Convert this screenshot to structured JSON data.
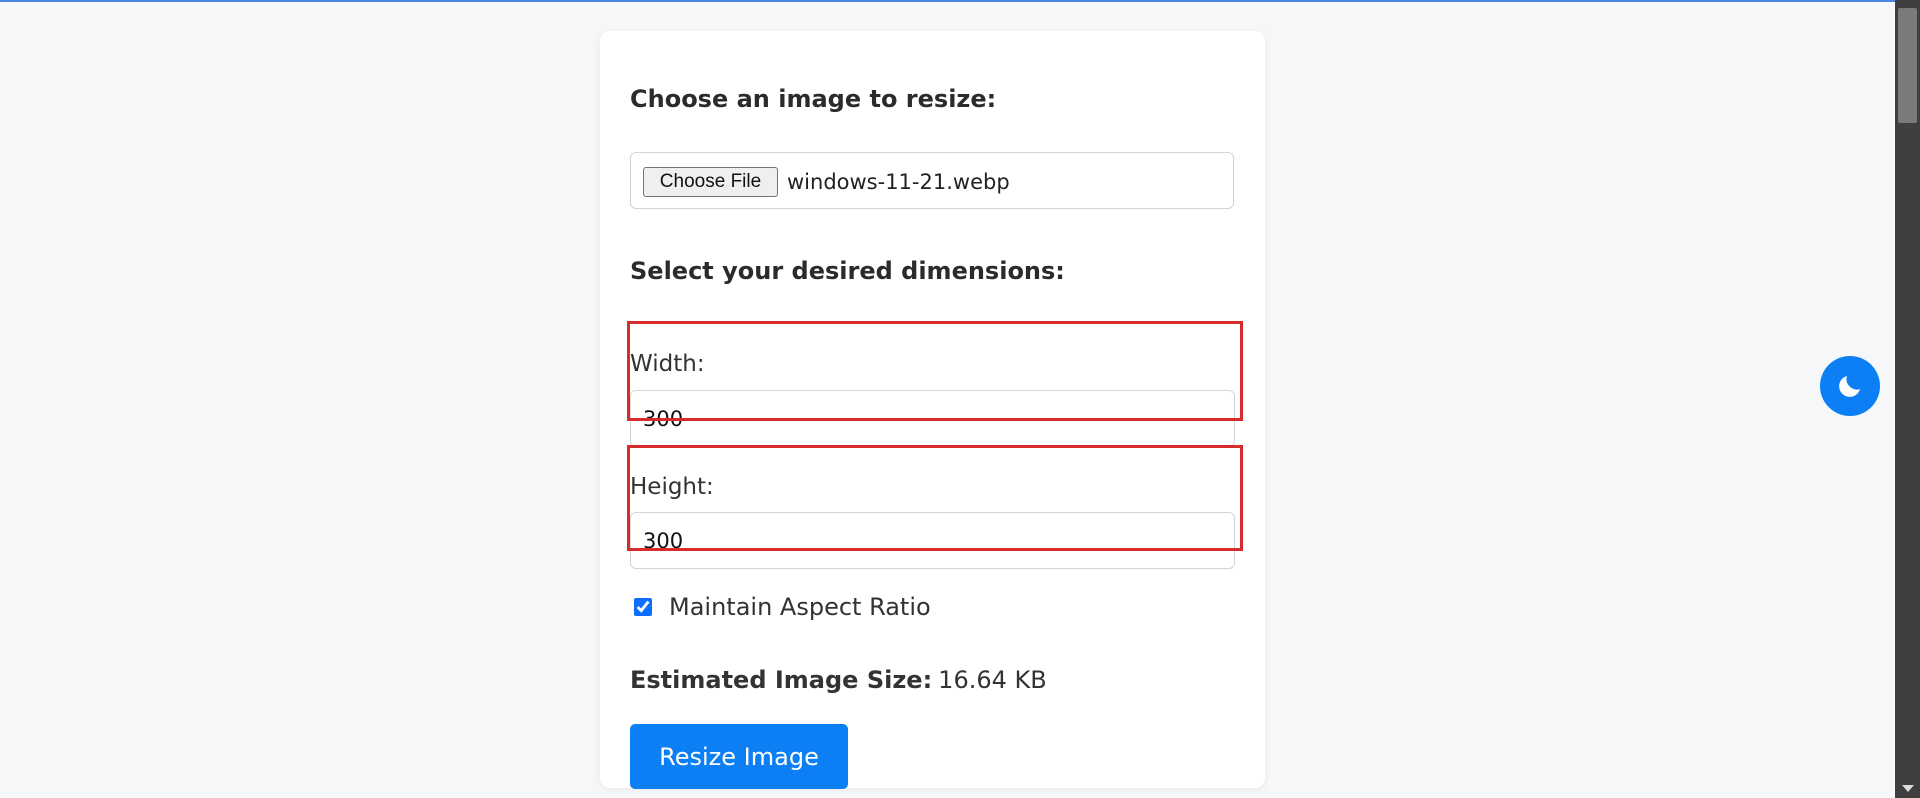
{
  "form": {
    "choose_title": "Choose an image to resize:",
    "choose_file_label": "Choose File",
    "file_name": "windows-11-21.webp",
    "dimensions_title": "Select your desired dimensions:",
    "width_label": "Width:",
    "width_value": "300",
    "height_label": "Height:",
    "height_value": "300",
    "maintain_aspect_label": "Maintain Aspect Ratio",
    "maintain_aspect_checked": true,
    "estimated_label": "Estimated Image Size:",
    "estimated_value": "16.64 KB",
    "resize_button_label": "Resize Image"
  },
  "theme_toggle": {
    "icon": "moon-icon"
  },
  "colors": {
    "accent": "#0d7ff5",
    "highlight": "#d62c2c",
    "background": "#f6f7f9"
  }
}
